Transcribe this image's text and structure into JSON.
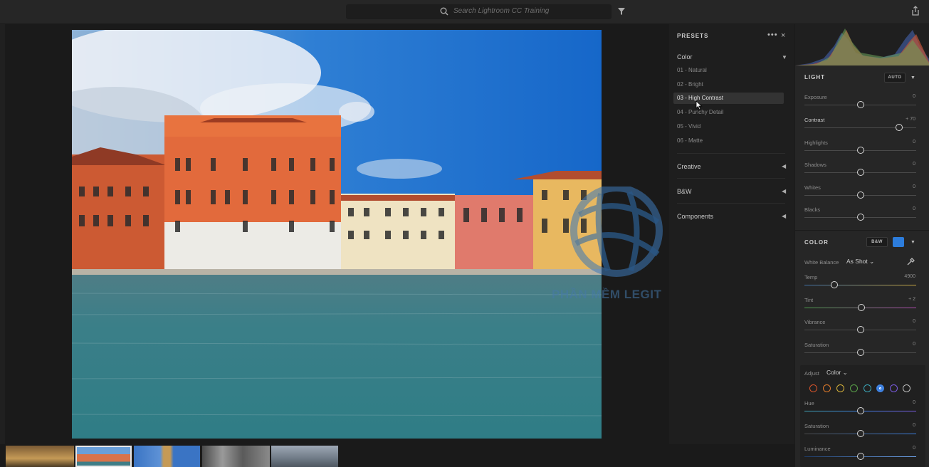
{
  "topbar": {
    "search_placeholder": "Search Lightroom CC Training"
  },
  "presets": {
    "title": "PRESETS",
    "more": "•••",
    "close": "×",
    "groups": [
      {
        "label": "Color",
        "expanded": true
      },
      {
        "label": "Creative",
        "expanded": false
      },
      {
        "label": "B&W",
        "expanded": false
      },
      {
        "label": "Components",
        "expanded": false
      }
    ],
    "color_items": [
      "01 - Natural",
      "02 - Bright",
      "03 - High Contrast",
      "04 - Punchy Detail",
      "05 - Vivid",
      "06 - Matte"
    ],
    "selected_index": 2
  },
  "light": {
    "title": "LIGHT",
    "auto_label": "AUTO",
    "sliders": [
      {
        "label": "Exposure",
        "value": "0",
        "level": 0.5
      },
      {
        "label": "Contrast",
        "value": "+ 70",
        "level": 0.85
      },
      {
        "label": "Highlights",
        "value": "0",
        "level": 0.5
      },
      {
        "label": "Shadows",
        "value": "0",
        "level": 0.5
      },
      {
        "label": "Whites",
        "value": "0",
        "level": 0.5
      },
      {
        "label": "Blacks",
        "value": "0",
        "level": 0.5
      }
    ]
  },
  "color": {
    "title": "COLOR",
    "bw_label": "B&W",
    "white_balance_label": "White Balance",
    "white_balance_value": "As Shot",
    "sliders": [
      {
        "label": "Temp",
        "value": "4900",
        "level": 0.27
      },
      {
        "label": "Tint",
        "value": "+ 2",
        "level": 0.51
      },
      {
        "label": "Vibrance",
        "value": "0",
        "level": 0.5
      },
      {
        "label": "Saturation",
        "value": "0",
        "level": 0.5
      }
    ],
    "adjust_label": "Adjust",
    "adjust_value": "Color",
    "hsl_sliders": [
      {
        "label": "Hue",
        "value": "0",
        "level": 0.5
      },
      {
        "label": "Saturation",
        "value": "0",
        "level": 0.5
      },
      {
        "label": "Luminance",
        "value": "0",
        "level": 0.5
      }
    ],
    "mix_colors": [
      "#d9542b",
      "#e07a2a",
      "#d6b23a",
      "#5aa34a",
      "#3aa4b6",
      "#3b7fe0",
      "#7a5adf",
      "#bdbdbd"
    ],
    "selected_color": 5
  },
  "watermark": {
    "text": "PHẦN MỀM LEGIT"
  }
}
